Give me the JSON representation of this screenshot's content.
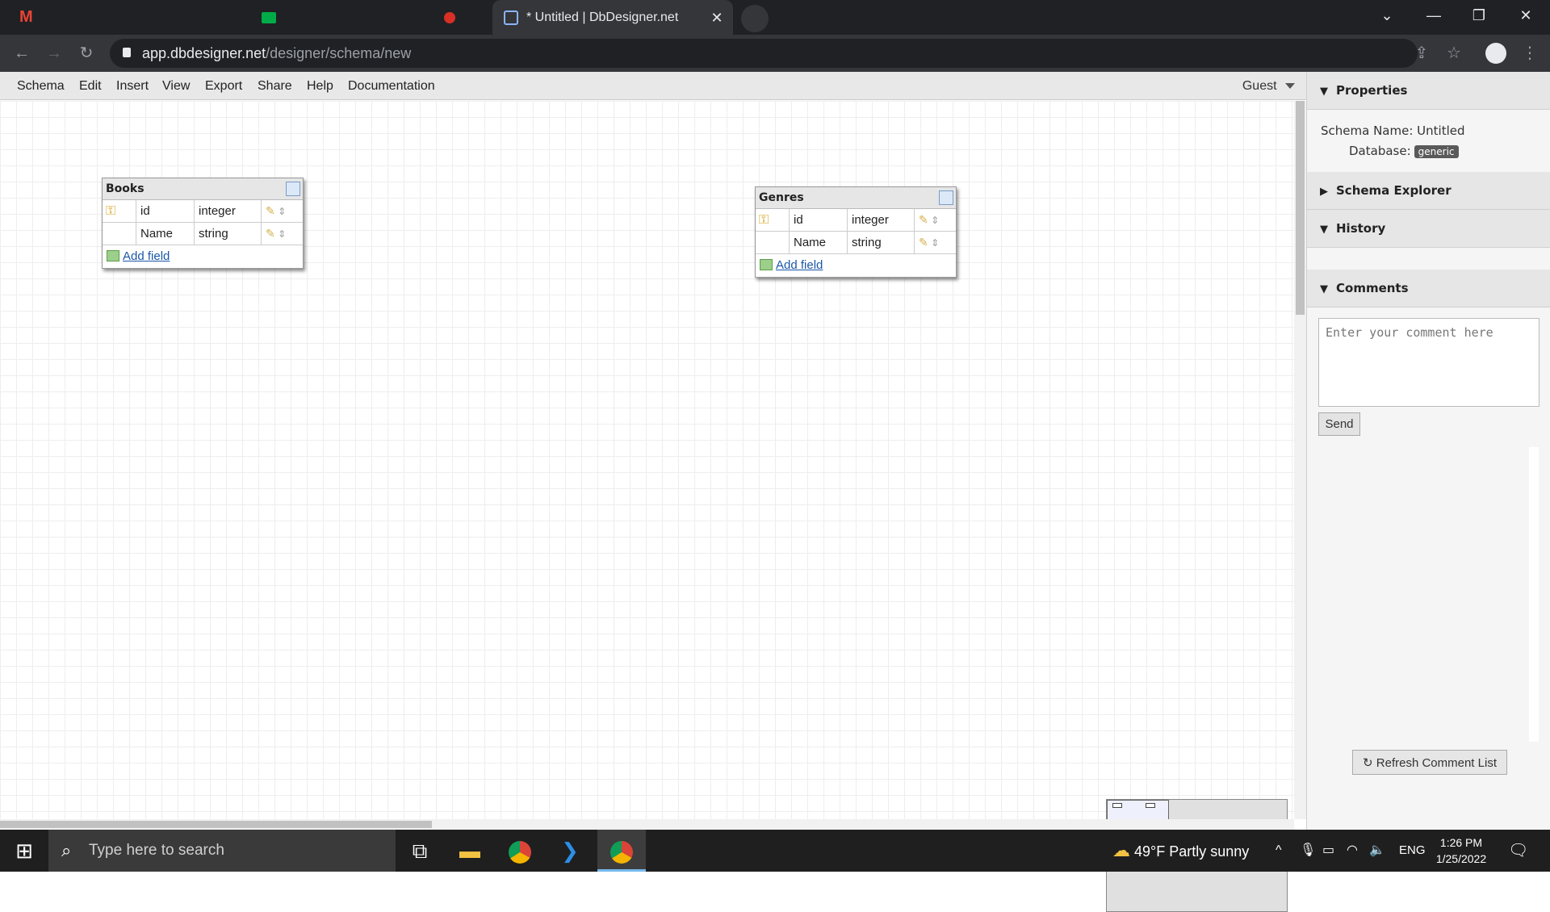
{
  "browser": {
    "active_tab_title": "* Untitled | DbDesigner.net",
    "tab_close": "✕",
    "url_host": "app.dbdesigner.net",
    "url_path": "/designer/schema/new",
    "icons": [
      "gmail-icon",
      "meet-icon",
      "record-icon",
      "dbdesigner-icon",
      "back-icon",
      "forward-icon",
      "reload-icon",
      "lock-icon",
      "share-icon",
      "star-icon",
      "profile-icon",
      "menu-icon"
    ]
  },
  "menu": {
    "items": [
      "Schema",
      "Edit",
      "Insert",
      "View",
      "Export",
      "Share",
      "Help",
      "Documentation"
    ],
    "user": "Guest"
  },
  "tables": [
    {
      "name": "Books",
      "fields": [
        {
          "name": "id",
          "type": "integer",
          "primary_key": true
        },
        {
          "name": "Name",
          "type": "string",
          "primary_key": false
        }
      ],
      "add_field_label": "Add field"
    },
    {
      "name": "Genres",
      "fields": [
        {
          "name": "id",
          "type": "integer",
          "primary_key": true
        },
        {
          "name": "Name",
          "type": "string",
          "primary_key": false
        }
      ],
      "add_field_label": "Add field"
    }
  ],
  "panel": {
    "properties_title": "Properties",
    "schema_name_label": "Schema Name:",
    "schema_name_value": "Untitled",
    "database_label": "Database:",
    "database_value": "generic",
    "schema_explorer_title": "Schema Explorer",
    "history_title": "History",
    "comments_title": "Comments",
    "comment_placeholder": "Enter your comment here",
    "send_label": "Send",
    "refresh_label": "Refresh Comment List"
  },
  "taskbar": {
    "search_placeholder": "Type here to search",
    "weather": "49°F  Partly sunny",
    "language": "ENG",
    "time": "1:26 PM",
    "date": "1/25/2022"
  },
  "colors": {
    "accent": "#1a56a8",
    "app_menu_bg": "#e8e8e8",
    "badge": "#5a5a5a"
  }
}
